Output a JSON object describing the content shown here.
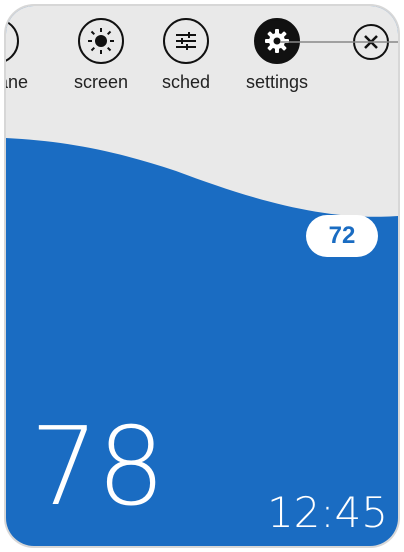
{
  "toolbar": {
    "items": [
      {
        "label": "ane",
        "icon": "arrow-up-right-icon"
      },
      {
        "label": "screen",
        "icon": "brightness-icon"
      },
      {
        "label": "sched",
        "icon": "sliders-icon"
      },
      {
        "label": "settings",
        "icon": "gear-icon",
        "active": true
      },
      {
        "label": "",
        "icon": "close-icon"
      }
    ]
  },
  "setpoint": {
    "value": "72"
  },
  "current": {
    "temperature": "78",
    "time": "12:45"
  },
  "colors": {
    "blue": "#1a6cc2",
    "top_bg": "#e9e9e9",
    "dark": "#111111"
  }
}
